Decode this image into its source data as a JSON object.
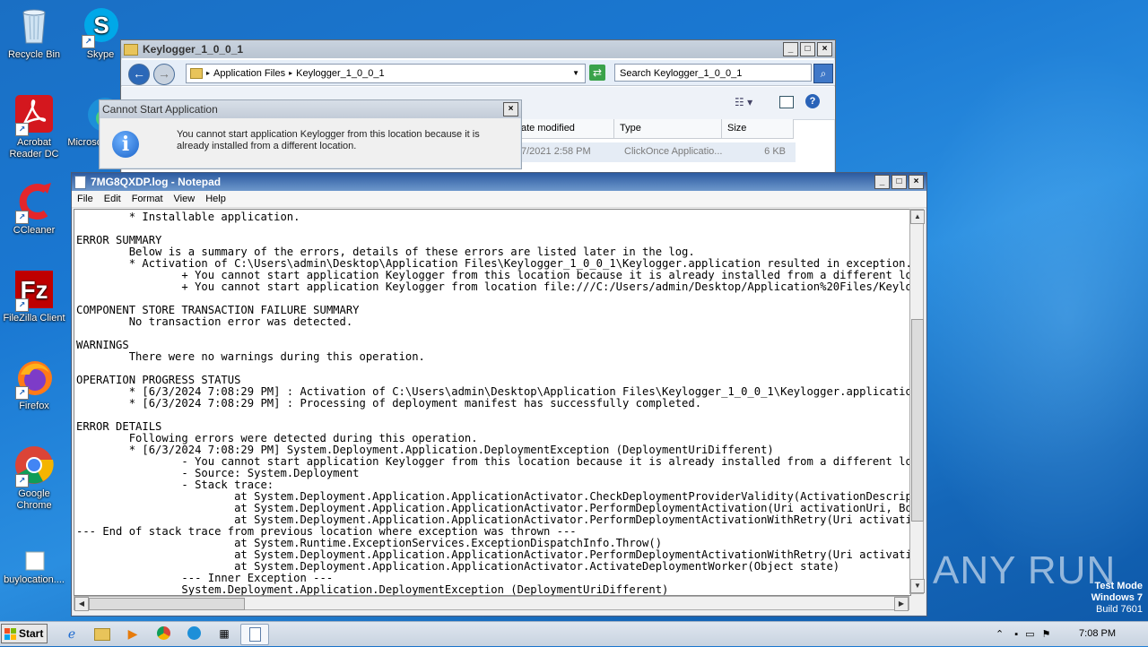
{
  "desktop": {
    "icons": [
      {
        "label": "Recycle Bin"
      },
      {
        "label": "Skype"
      },
      {
        "label": "Acrobat Reader DC"
      },
      {
        "label": "Microsoft Edge"
      },
      {
        "label": "CCleaner"
      },
      {
        "label": "FileZilla Client"
      },
      {
        "label": "Firefox"
      },
      {
        "label": "Google Chrome"
      },
      {
        "label": "buylocation...."
      }
    ],
    "watermark": "ANY RUN",
    "test_mode": {
      "line1": "Test Mode",
      "line2": "Windows 7",
      "line3": "Build 7601"
    }
  },
  "explorer": {
    "title": "Keylogger_1_0_0_1",
    "breadcrumb": [
      "Application Files",
      "Keylogger_1_0_0_1"
    ],
    "search_placeholder": "Search Keylogger_1_0_0_1",
    "columns": [
      "ate modified",
      "Type",
      "Size"
    ],
    "row": {
      "date": "7/2021 2:58 PM",
      "type": "ClickOnce Applicatio...",
      "size": "6 KB"
    }
  },
  "error_dialog": {
    "title": "Cannot Start Application",
    "message": "You cannot start application Keylogger from this location because it is already installed from a different location."
  },
  "notepad": {
    "title": "7MG8QXDP.log - Notepad",
    "menu": [
      "File",
      "Edit",
      "Format",
      "View",
      "Help"
    ],
    "text": "        * Installable application.\n\nERROR SUMMARY\n        Below is a summary of the errors, details of these errors are listed later in the log.\n        * Activation of C:\\Users\\admin\\Desktop\\Application Files\\Keylogger_1_0_0_1\\Keylogger.application resulted in exception. Following failure messages were detected:\n                + You cannot start application Keylogger from this location because it is already installed from a different location.\n                + You cannot start application Keylogger from location file:///C:/Users/admin/Desktop/Application%20Files/Keylogger_1_0_0_1/Keylogger.application\n\nCOMPONENT STORE TRANSACTION FAILURE SUMMARY\n        No transaction error was detected.\n\nWARNINGS\n        There were no warnings during this operation.\n\nOPERATION PROGRESS STATUS\n        * [6/3/2024 7:08:29 PM] : Activation of C:\\Users\\admin\\Desktop\\Application Files\\Keylogger_1_0_0_1\\Keylogger.application has started.\n        * [6/3/2024 7:08:29 PM] : Processing of deployment manifest has successfully completed.\n\nERROR DETAILS\n        Following errors were detected during this operation.\n        * [6/3/2024 7:08:29 PM] System.Deployment.Application.DeploymentException (DeploymentUriDifferent)\n                - You cannot start application Keylogger from this location because it is already installed from a different location.\n                - Source: System.Deployment\n                - Stack trace:\n                        at System.Deployment.Application.ApplicationActivator.CheckDeploymentProviderValidity(ActivationDescription actDesc, SubscriptionState& subState)\n                        at System.Deployment.Application.ApplicationActivator.PerformDeploymentActivation(Uri activationUri, Boolean isShortcut)\n                        at System.Deployment.Application.ApplicationActivator.PerformDeploymentActivationWithRetry(Uri activationUri, Boolean isShortcut)\n--- End of stack trace from previous location where exception was thrown ---\n                        at System.Runtime.ExceptionServices.ExceptionDispatchInfo.Throw()\n                        at System.Deployment.Application.ApplicationActivator.PerformDeploymentActivationWithRetry(Uri activationUri, Boolean isShortcut)\n                        at System.Deployment.Application.ApplicationActivator.ActivateDeploymentWorker(Object state)\n                --- Inner Exception ---\n                System.Deployment.Application.DeploymentException (DeploymentUriDifferent)"
  },
  "taskbar": {
    "start_label": "Start",
    "clock": "7:08 PM"
  }
}
